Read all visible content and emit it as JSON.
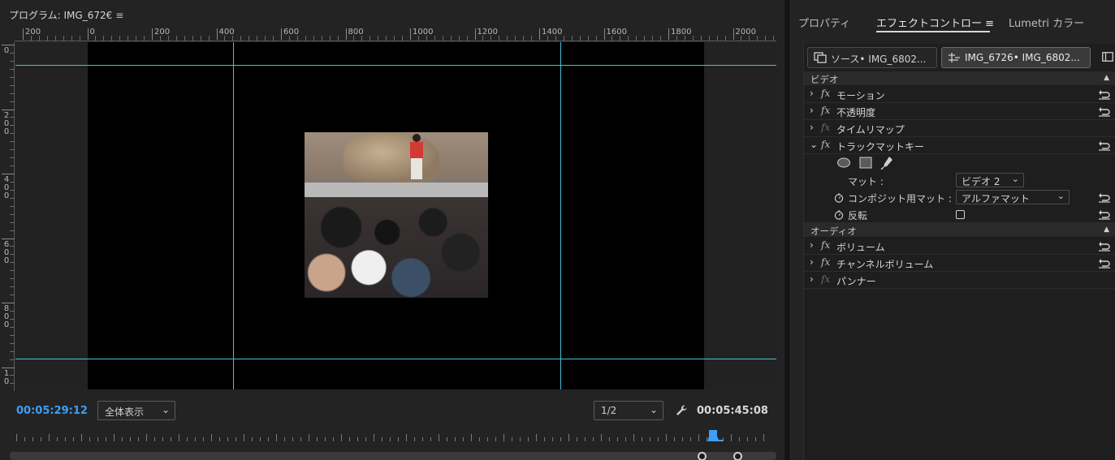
{
  "program_monitor": {
    "title": "プログラム: IMG_672€",
    "menu_glyph": "≡",
    "h_ruler_labels": [
      "200",
      "0",
      "200",
      "400",
      "600",
      "800",
      "1000",
      "1200",
      "1400",
      "1600",
      "1800",
      "2000"
    ],
    "v_ruler_labels": [
      "0",
      "200",
      "400",
      "600",
      "800",
      "10"
    ],
    "current_time": "00:05:29:12",
    "zoom": "全体表示",
    "resolution": "1/2",
    "duration": "00:05:45:08"
  },
  "right_panel": {
    "tabs": [
      {
        "label": "プロパティ"
      },
      {
        "label": "エフェクトコントロー ≡"
      },
      {
        "label": "Lumetri カラー"
      }
    ],
    "active_tab_index": 1,
    "source_pill": "ソース• IMG_6802...",
    "sequence_pill": "IMG_6726• IMG_6802...",
    "video_section": "ビデオ",
    "audio_section": "オーディオ",
    "effects": {
      "motion": "モーション",
      "opacity": "不透明度",
      "time_remap": "タイムリマップ",
      "track_matte": "トラックマットキー"
    },
    "fx_badge": "fx",
    "track_matte_props": {
      "matte_label": "マット :",
      "matte_value": "ビデオ 2",
      "composite_label": "コンポジット用マット :",
      "composite_value": "アルファマット",
      "invert_label": "反転"
    },
    "audio_effects": {
      "volume": "ボリューム",
      "channel_volume": "チャンネルボリューム",
      "panner": "パンナー"
    }
  },
  "colors": {
    "accent_time": "#3d9ff4",
    "guide_line": "#48c3d6"
  }
}
